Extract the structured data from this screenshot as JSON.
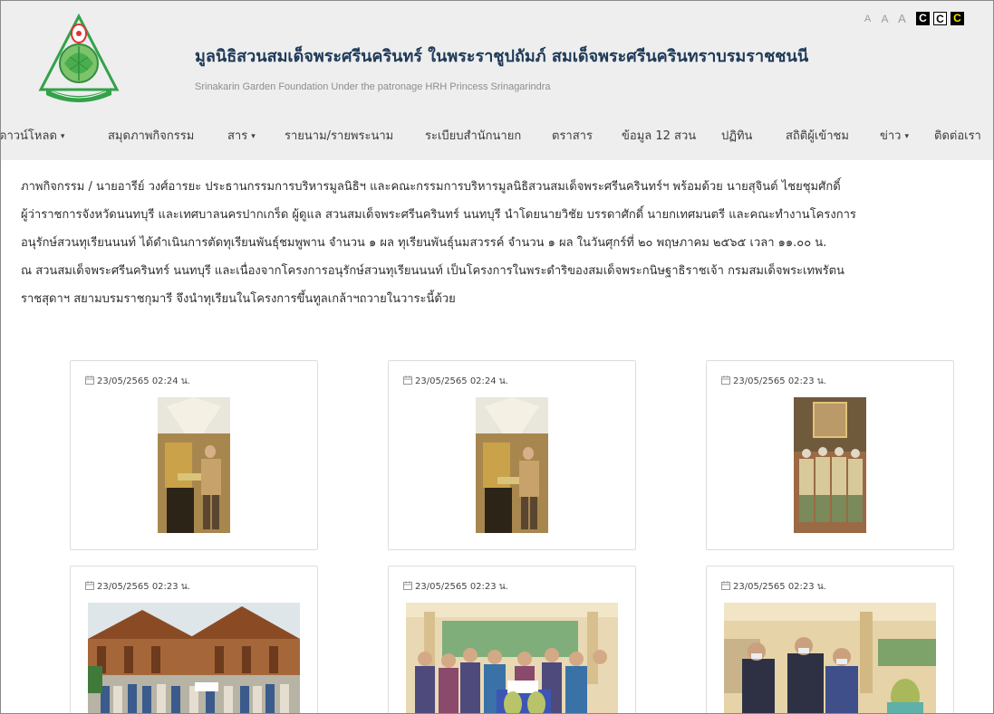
{
  "header": {
    "title": "มูลนิธิสวนสมเด็จพระศรีนครินทร์ ในพระราชูปถัมภ์ สมเด็จพระศรีนครินทราบรมราชชนนี",
    "subtitle": "Srinakarin Garden Foundation Under the patronage HRH Princess Srinagarindra",
    "text_size_buttons": [
      "A",
      "A",
      "A"
    ],
    "contrast_buttons": [
      "C",
      "C",
      "C"
    ],
    "colors": {
      "header_bg": "#eeeeee",
      "title_color": "#1f3a58",
      "logo_green": "#33a24a"
    }
  },
  "nav": {
    "items": [
      {
        "label": "ดาวน์โหลด",
        "dropdown": true
      },
      {
        "label": "สมุดภาพกิจกรรม",
        "dropdown": false
      },
      {
        "label": "สาร",
        "dropdown": true
      },
      {
        "label": "รายนาม/รายพระนาม",
        "dropdown": false
      },
      {
        "label": "ระเบียบสำนักนายก",
        "dropdown": false
      },
      {
        "label": "ตราสาร",
        "dropdown": false
      },
      {
        "label": "ข้อมูล 12 สวน",
        "dropdown": false
      },
      {
        "label": "ปฏิทิน",
        "dropdown": false
      },
      {
        "label": "สถิติผู้เข้าชม",
        "dropdown": false
      },
      {
        "label": "ข่าว",
        "dropdown": true
      },
      {
        "label": "ติดต่อเรา",
        "dropdown": false
      }
    ]
  },
  "article": {
    "lines": [
      "ภาพกิจกรรม / นายอารีย์ วงศ์อารยะ ประธานกรรมการบริหารมูลนิธิฯ และคณะกรรมการบริหารมูลนิธิสวนสมเด็จพระศรีนครินทร์ฯ พร้อมด้วย นายสุจินต์ ไชยชุมศักดิ์",
      "ผู้ว่าราชการจังหวัดนนทบุรี และเทศบาลนครปากเกร็ด ผู้ดูแล สวนสมเด็จพระศรีนครินทร์ นนทบุรี นำโดยนายวิชัย บรรดาศักดิ์ นายกเทศมนตรี และคณะทำงานโครงการ",
      "อนุรักษ์สวนทุเรียนนนท์ ได้ดำเนินการตัดทุเรียนพันธุ์ชมพูพาน จำนวน ๑ ผล ทุเรียนพันธุ์นมสวรรค์ จำนวน ๑ ผล ในวันศุกร์ที่ ๒๐ พฤษภาคม ๒๕๖๕ เวลา ๑๑.๐๐ น.",
      "ณ สวนสมเด็จพระศรีนครินทร์ นนทบุรี และเนื่องจากโครงการอนุรักษ์สวนทุเรียนนนท์ เป็นโครงการในพระดำริของสมเด็จพระกนิษฐาธิราชเจ้า กรมสมเด็จพระเทพรัตน",
      "ราชสุดาฯ สยามบรมราชกุมารี จึงนำทุเรียนในโครงการขึ้นทูลเกล้าฯถวายในวาระนี้ด้วย"
    ]
  },
  "gallery": {
    "cards": [
      {
        "date": "23/05/2565 02:24 น."
      },
      {
        "date": "23/05/2565 02:24 น."
      },
      {
        "date": "23/05/2565 02:23 น."
      },
      {
        "date": "23/05/2565 02:23 น."
      },
      {
        "date": "23/05/2565 02:23 น."
      },
      {
        "date": "23/05/2565 02:23 น."
      }
    ]
  }
}
